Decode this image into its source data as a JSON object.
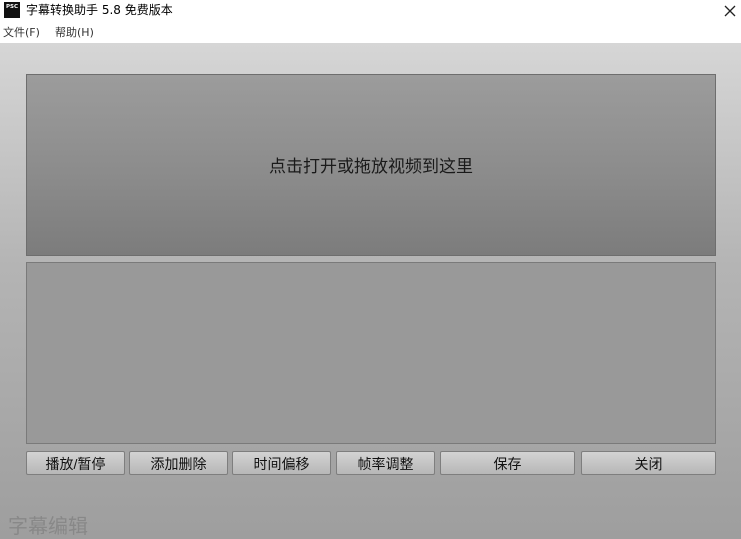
{
  "window": {
    "title": "字幕转换助手 5.8 免费版本",
    "icon_text": "PSC",
    "icon": "app-logo-icon",
    "close_icon": "close-icon"
  },
  "menu": {
    "items": [
      {
        "label": "文件(F)"
      },
      {
        "label": "帮助(H)"
      }
    ]
  },
  "video_panel": {
    "text": "点击打开或拖放视频到这里"
  },
  "toolbar": {
    "buttons": [
      {
        "label": "播放/暂停"
      },
      {
        "label": "添加删除"
      },
      {
        "label": "时间偏移"
      },
      {
        "label": "帧率调整"
      },
      {
        "label": "保存"
      },
      {
        "label": "关闭"
      }
    ]
  },
  "watermark": {
    "text": "字幕编辑"
  },
  "colors": {
    "title_bar_bg": "#ffffff",
    "client_bg_top": "#d6d6d6",
    "client_bg_bottom": "#9e9e9e",
    "panel_bg": "#8a8a8a",
    "button_bg": "#c5c5c5",
    "text": "#111111"
  }
}
